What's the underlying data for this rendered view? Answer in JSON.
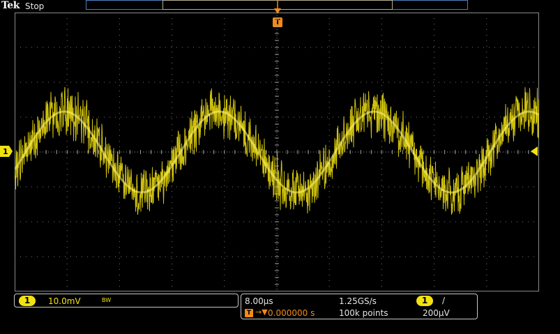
{
  "header": {
    "brand": "Tek",
    "acquisition_state": "Stop"
  },
  "trigger": {
    "position_marker_label": "T",
    "level_marker_color": "#f2e20f"
  },
  "channel1": {
    "marker_label": "1",
    "scale": "10.0mV",
    "bandwidth_flag": "BW",
    "color": "#f2e20f"
  },
  "horizontal": {
    "time_per_div": "8.00µs",
    "sample_rate": "1.25GS/s",
    "trigger_badge": "T",
    "delay_arrow": "→▼",
    "delay": "0.000000 s",
    "record_length": "100k points",
    "trigger_source": "1",
    "trigger_slope": "/",
    "trigger_level": "200µV"
  },
  "colors": {
    "trace": "#f2e20f",
    "accent": "#f28a1a",
    "grid": "#7a7a7a",
    "background": "#000000"
  }
}
